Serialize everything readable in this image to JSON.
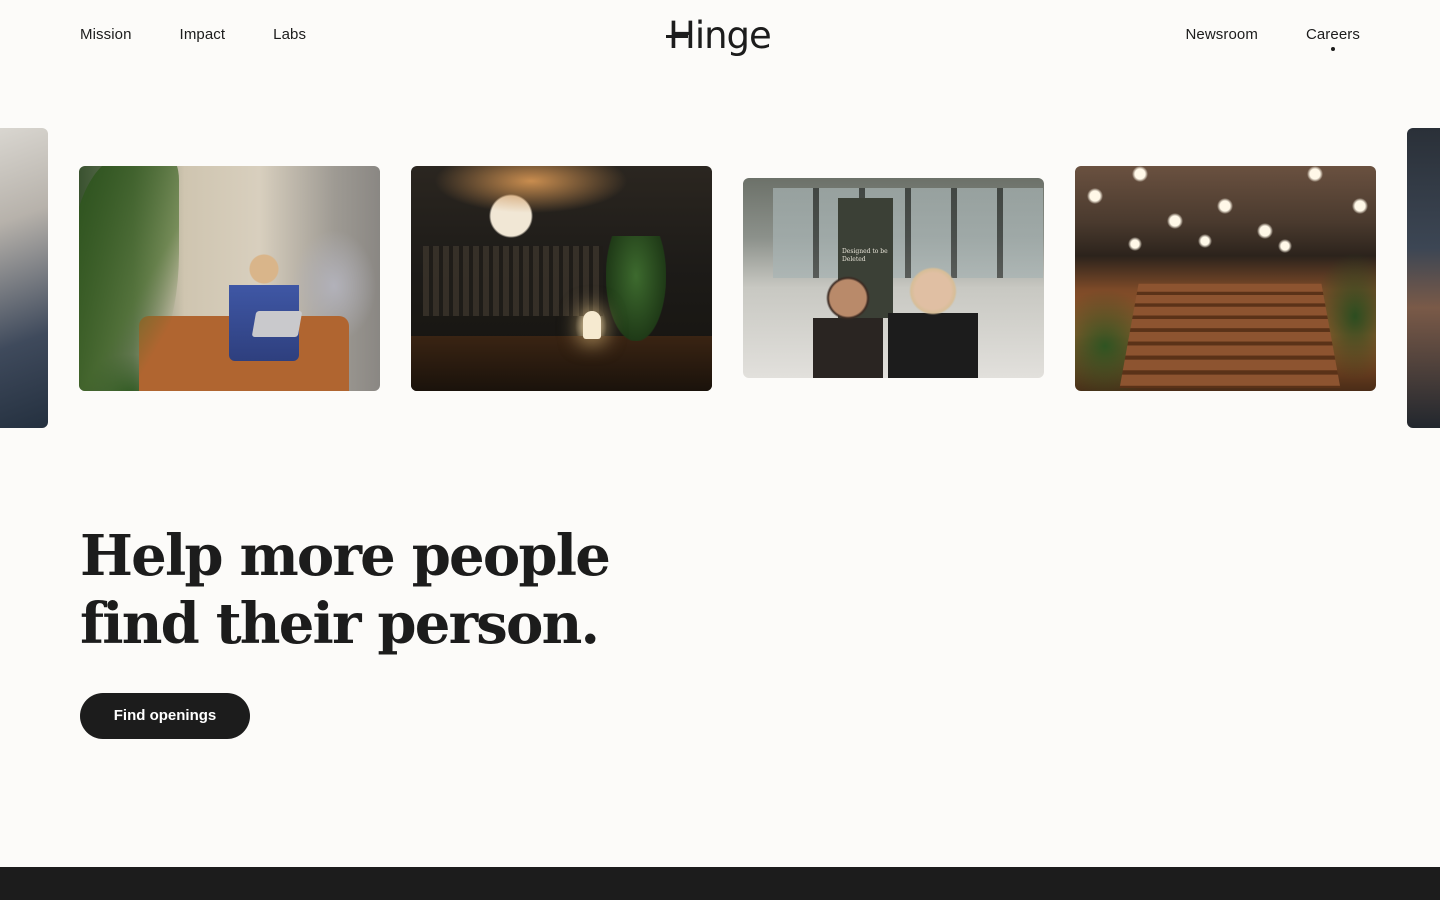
{
  "header": {
    "nav_left": [
      "Mission",
      "Impact",
      "Labs"
    ],
    "nav_right": [
      "Newsroom",
      "Careers"
    ],
    "logo": "Hinge",
    "active_item": "Careers"
  },
  "gallery": {
    "photos": [
      {
        "alt": "person-cropped-left"
      },
      {
        "alt": "woman-on-sofa-with-laptop"
      },
      {
        "alt": "dark-library-lounge"
      },
      {
        "alt": "two-women-talking",
        "banner_text": "Designed to be Deleted"
      },
      {
        "alt": "wooden-stairs-with-pendant-lights"
      },
      {
        "alt": "person-cropped-right"
      }
    ]
  },
  "hero": {
    "headline_line1": "Help more people",
    "headline_line2": "find their person.",
    "cta_label": "Find openings"
  },
  "colors": {
    "background": "#fcfbf9",
    "text": "#1c1c1c",
    "button_bg": "#1c1c1c",
    "button_text": "#ffffff"
  }
}
